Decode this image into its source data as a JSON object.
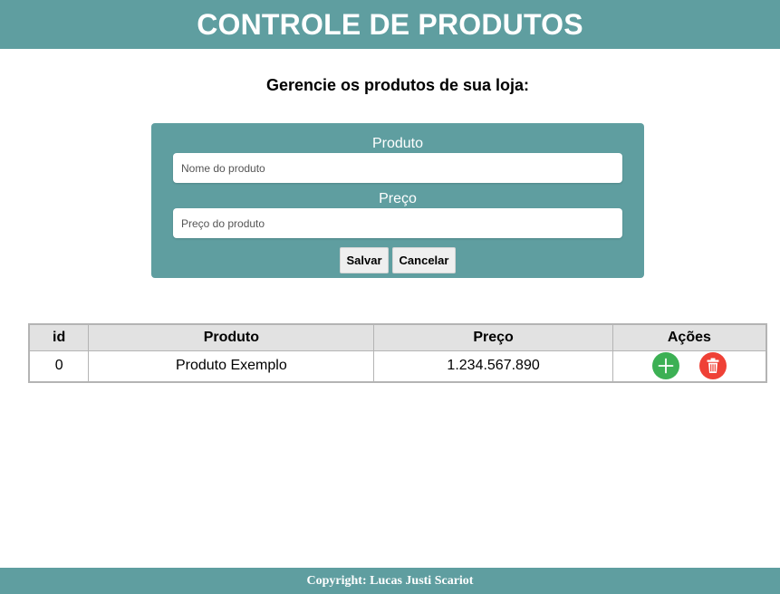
{
  "header": {
    "title": "CONTROLE DE PRODUTOS"
  },
  "subtitle": "Gerencie os produtos de sua loja:",
  "form": {
    "product_label": "Produto",
    "product_placeholder": "Nome do produto",
    "product_value": "",
    "price_label": "Preço",
    "price_placeholder": "Preço do produto",
    "price_value": "",
    "save_label": "Salvar",
    "cancel_label": "Cancelar"
  },
  "table": {
    "headers": [
      "id",
      "Produto",
      "Preço",
      "Ações"
    ],
    "rows": [
      {
        "id": "0",
        "produto": "Produto Exemplo",
        "preco": "1.234.567.890",
        "add_icon": "plus-icon",
        "delete_icon": "trash-icon"
      }
    ]
  },
  "footer": {
    "text": "Copyright: Lucas Justi Scariot"
  },
  "colors": {
    "accent": "#5f9ea0",
    "add": "#3cb054",
    "delete": "#ef4136",
    "table_header_bg": "#e2e2e2"
  }
}
